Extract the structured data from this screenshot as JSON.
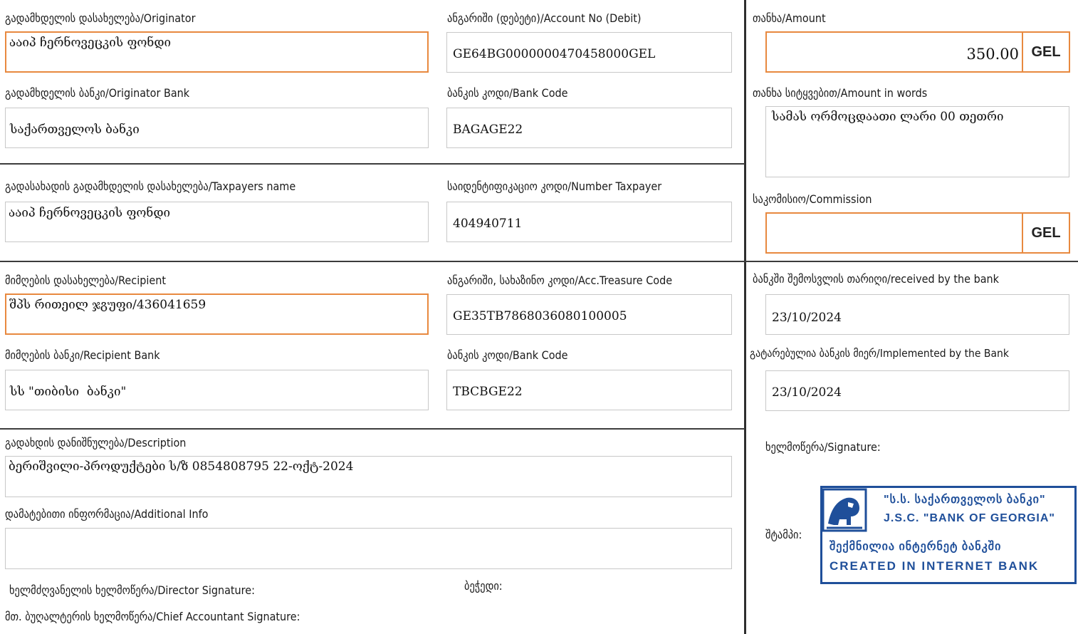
{
  "originator": {
    "label": "გადამხდელის დასახელება/Originator",
    "value": "ააიპ ჩერნოვეცკის ფონდი"
  },
  "account_debit": {
    "label": "ანგარიში (დებეტი)/Account No (Debit)",
    "value": "GE64BG0000000470458000GEL"
  },
  "amount": {
    "label": "თანხა/Amount",
    "value": "350.00",
    "currency": "GEL"
  },
  "originator_bank": {
    "label": "გადამხდელის ბანკი/Originator Bank",
    "value": "საქართველოს ბანკი"
  },
  "originator_bank_code": {
    "label": "ბანკის კოდი/Bank Code",
    "value": "BAGAGE22"
  },
  "amount_words": {
    "label": "თანხა სიტყვებით/Amount in words",
    "value": "სამას ორმოცდაათი ლარი 00 თეთრი"
  },
  "taxpayer": {
    "label": "გადასახადის გადამხდელის დასახელება/Taxpayers name",
    "value": "ააიპ ჩერნოვეცკის ფონდი"
  },
  "taxpayer_id": {
    "label": "საიდენტიფიკაციო კოდი/Number Taxpayer",
    "value": "404940711"
  },
  "commission": {
    "label": "საკომისიო/Commission",
    "value": "",
    "currency": "GEL"
  },
  "recipient": {
    "label": "მიმღების დასახელება/Recipient",
    "value": "შპს რითეილ ჯგუფი/436041659"
  },
  "recipient_account": {
    "label": "ანგარიში, სახაზინო კოდი/Acc.Treasure Code",
    "value": "GE35TB7868036080100005"
  },
  "received_date": {
    "label": "ბანკში შემოსვლის თარიღი/received by the bank",
    "value": "23/10/2024"
  },
  "recipient_bank": {
    "label": "მიმღების ბანკი/Recipient Bank",
    "value": "სს \"თიბისი  ბანკი\""
  },
  "recipient_bank_code": {
    "label": "ბანკის კოდი/Bank Code",
    "value": "TBCBGE22"
  },
  "implemented_date": {
    "label": "გატარებულია ბანკის მიერ/Implemented by the Bank",
    "value": "23/10/2024"
  },
  "description": {
    "label": "გადახდის დანიშნულება/Description",
    "value": "ბერიშვილი-პროდუქტები ს/ზ 0854808795 22-ოქტ-2024"
  },
  "additional_info": {
    "label": "დამატებითი ინფორმაცია/Additional Info",
    "value": ""
  },
  "signature_label": "ხელმოწერა/Signature:",
  "stamp_label": "შტამპი:",
  "director_signature_label": "ხელმძღვანელის ხელმოწერა/Director Signature:",
  "seal_label": "ბეჭედი:",
  "chief_accountant_label": "მთ. ბუღალტერის ხელმოწერა/Chief Accountant Signature:",
  "stamp": {
    "line1": "\"ს.ს. საქართველოს ბანკი\"",
    "line2": "J.S.C. \"BANK OF GEORGIA\"",
    "line3": "შექმნილია ინტერნეტ ბანკში",
    "line4": "CREATED IN INTERNET BANK",
    "color": "#1f4f9a"
  },
  "colors": {
    "highlight_border": "#e8893f",
    "field_border": "#c8c8c8",
    "divider": "#3c3c3c"
  }
}
